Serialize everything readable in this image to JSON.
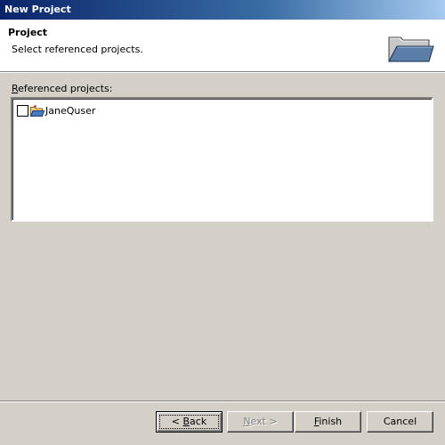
{
  "window": {
    "title": "New Project"
  },
  "header": {
    "title": "Project",
    "description": "Select referenced projects.",
    "icon": "open-folder-icon"
  },
  "referenced_projects": {
    "label_mnemonic": "R",
    "label_rest": "eferenced projects:",
    "items": [
      {
        "label": "JaneQuser",
        "checked": false,
        "icon": "project-folder-icon"
      }
    ]
  },
  "buttons": {
    "back": {
      "prefix": "< ",
      "mnemonic": "B",
      "rest": "ack",
      "enabled": true,
      "default": true
    },
    "next": {
      "prefix": "",
      "mnemonic": "N",
      "rest": "ext >",
      "enabled": false
    },
    "finish": {
      "prefix": "",
      "mnemonic": "F",
      "rest": "inish",
      "enabled": true
    },
    "cancel": {
      "label": "Cancel",
      "enabled": true
    }
  },
  "colors": {
    "title_bar_start": "#0a246a",
    "title_bar_end": "#a6caf0",
    "dialog_background": "#d4d0c8",
    "header_background": "#ffffff"
  }
}
